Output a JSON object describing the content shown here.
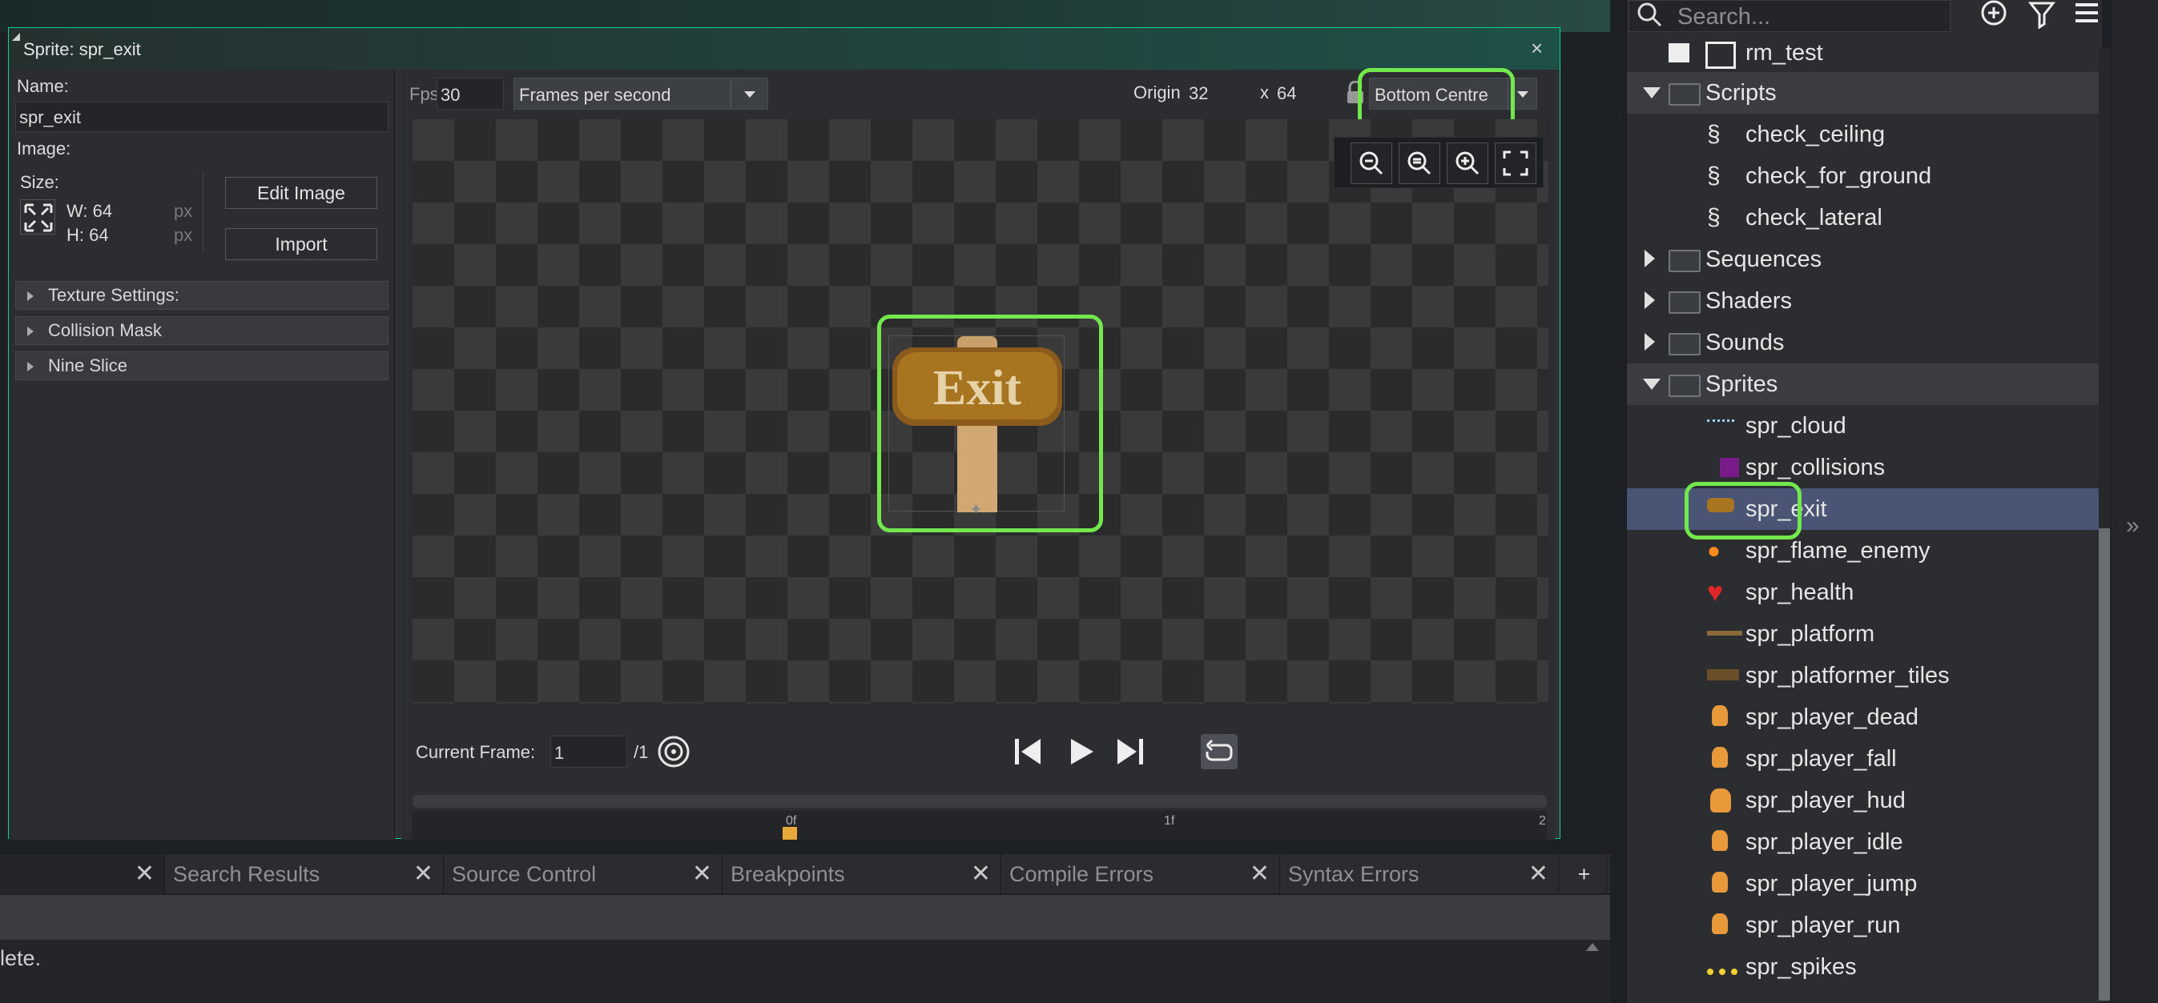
{
  "sprite_editor": {
    "title": "Sprite: spr_exit",
    "close": "×",
    "name_label": "Name:",
    "name_value": "spr_exit",
    "image_label": "Image:",
    "size_label": "Size:",
    "width": "W: 64",
    "height": "H: 64",
    "unit": "px",
    "edit_image": "Edit Image",
    "import": "Import",
    "sections": [
      "Texture Settings:",
      "Collision Mask",
      "Nine Slice"
    ],
    "fps_label": "Fps",
    "fps_value": "30",
    "fps_mode": "Frames per second",
    "origin_label": "Origin",
    "origin_x": "32",
    "origin_y_label": "x",
    "origin_y": "64",
    "origin_preset": "Bottom Centre",
    "sprite_text": "Exit",
    "current_frame_label": "Current Frame:",
    "current_frame": "1",
    "frame_total": "/1",
    "timeline_ticks": [
      "0f",
      "1f",
      "2"
    ]
  },
  "bottom_tabs": [
    {
      "label": ""
    },
    {
      "label": "Search Results"
    },
    {
      "label": "Source Control"
    },
    {
      "label": "Breakpoints"
    },
    {
      "label": "Compile Errors"
    },
    {
      "label": "Syntax Errors"
    }
  ],
  "add_tab": "+",
  "output_text": "lete.",
  "asset_browser": {
    "search_placeholder": "Search...",
    "rows": [
      {
        "label": "rm_test"
      },
      {
        "label": "Scripts"
      },
      {
        "label": "check_ceiling"
      },
      {
        "label": "check_for_ground"
      },
      {
        "label": "check_lateral"
      },
      {
        "label": "Sequences"
      },
      {
        "label": "Shaders"
      },
      {
        "label": "Sounds"
      },
      {
        "label": "Sprites"
      },
      {
        "label": "spr_cloud"
      },
      {
        "label": "spr_collisions"
      },
      {
        "label": "spr_exit"
      },
      {
        "label": "spr_flame_enemy"
      },
      {
        "label": "spr_health"
      },
      {
        "label": "spr_platform"
      },
      {
        "label": "spr_platformer_tiles"
      },
      {
        "label": "spr_player_dead"
      },
      {
        "label": "spr_player_fall"
      },
      {
        "label": "spr_player_hud"
      },
      {
        "label": "spr_player_idle"
      },
      {
        "label": "spr_player_jump"
      },
      {
        "label": "spr_player_run"
      },
      {
        "label": "spr_spikes"
      }
    ]
  },
  "colors": {
    "highlight": "#72e84c",
    "selected_row": "#4a5475",
    "accent": "#10d48a"
  }
}
